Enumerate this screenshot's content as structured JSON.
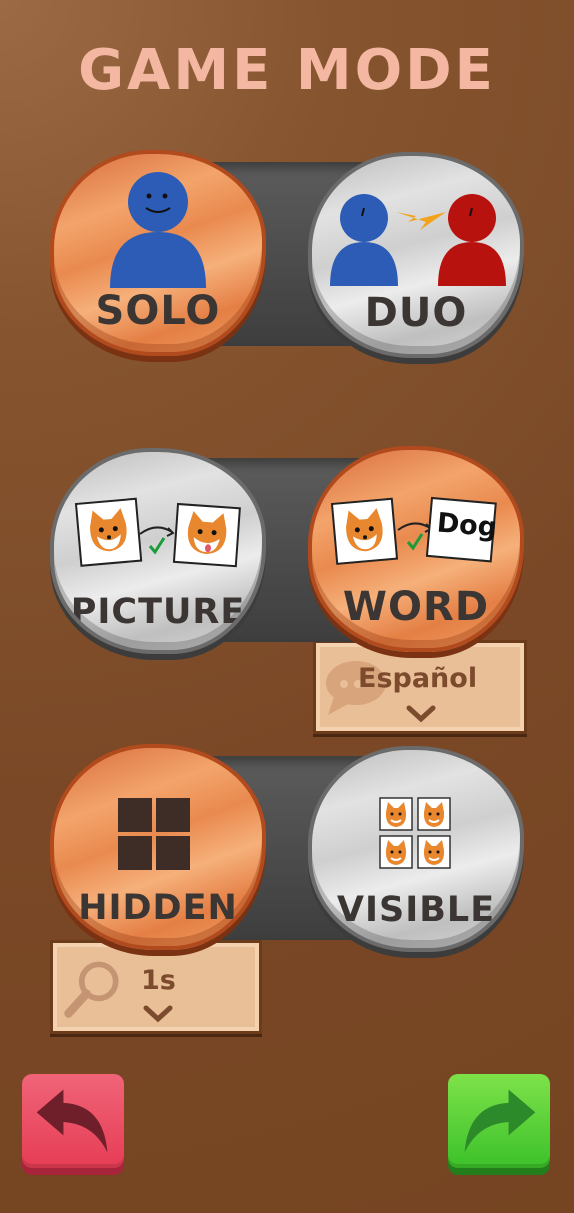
{
  "title": "GAME MODE",
  "players": {
    "left_label": "SOLO",
    "right_label": "DUO",
    "selected": "SOLO"
  },
  "answer": {
    "left_label": "PICTURE",
    "right_label": "WORD",
    "selected": "WORD",
    "word_card_text": "Dog",
    "language_value": "Español"
  },
  "cards": {
    "left_label": "HIDDEN",
    "right_label": "VISIBLE",
    "selected": "HIDDEN",
    "peek_value": "1s"
  },
  "colors": {
    "selected": "#f09a5e",
    "unselected": "#cfcfcf",
    "player_blue": "#2d5cb6",
    "player_red": "#b8120f",
    "back_button": "#e8455c",
    "next_button": "#49c62f"
  },
  "icons": {
    "back": "curved-arrow-left-icon",
    "next": "curved-arrow-right-icon",
    "language": "speech-bubble-icon",
    "peek": "magnifier-icon",
    "dropdown": "chevron-down-icon"
  }
}
